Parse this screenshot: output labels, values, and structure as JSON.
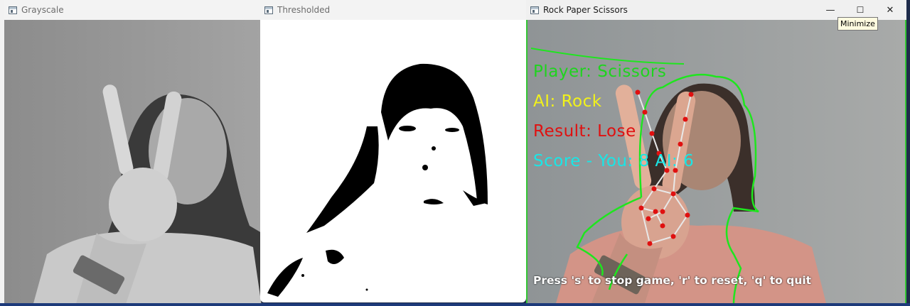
{
  "windows": {
    "grayscale": {
      "title": "Grayscale"
    },
    "thresholded": {
      "title": "Thresholded"
    },
    "rps": {
      "title": "Rock Paper Scissors",
      "controls": {
        "minimize": "—",
        "maximize": "☐",
        "close": "✕"
      },
      "tooltip": "Minimize"
    }
  },
  "game": {
    "player_line": "Player: Scissors",
    "ai_line": "AI: Rock",
    "result_line": "Result: Lose",
    "score_line": "Score - You: 8  AI: 6",
    "instructions": "Press 's' to stop game, 'r' to reset, 'q' to quit"
  },
  "colors": {
    "player": "#1ed41e",
    "ai": "#f2f21a",
    "result": "#e01010",
    "score": "#19e6e6",
    "contour": "#1ee61e",
    "landmark": "#e01010",
    "skeleton": "#e8e8e8",
    "window_border": "#35c535"
  },
  "icons": [
    "app-window-icon",
    "minimize-icon",
    "maximize-icon",
    "close-icon"
  ]
}
